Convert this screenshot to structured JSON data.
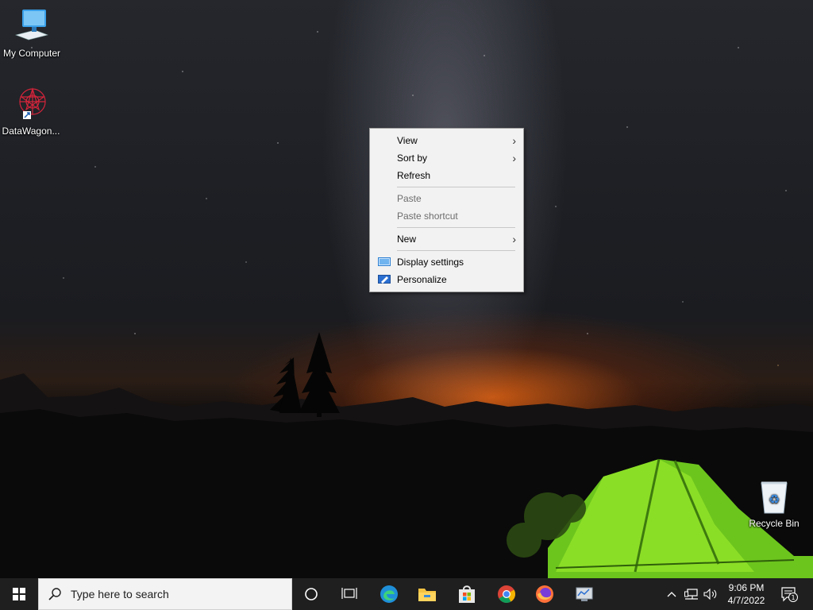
{
  "desktop": {
    "icons": [
      {
        "label": "My Computer"
      },
      {
        "label": "DataWagon..."
      },
      {
        "label": "Recycle Bin"
      }
    ]
  },
  "context_menu": {
    "items": [
      {
        "label": "View",
        "has_submenu": true,
        "enabled": true
      },
      {
        "label": "Sort by",
        "has_submenu": true,
        "enabled": true
      },
      {
        "label": "Refresh",
        "has_submenu": false,
        "enabled": true
      },
      {
        "label": "Paste",
        "has_submenu": false,
        "enabled": false
      },
      {
        "label": "Paste shortcut",
        "has_submenu": false,
        "enabled": false
      },
      {
        "label": "New",
        "has_submenu": true,
        "enabled": true
      },
      {
        "label": "Display settings",
        "icon": "display-icon",
        "enabled": true
      },
      {
        "label": "Personalize",
        "icon": "personalize-icon",
        "enabled": true
      }
    ]
  },
  "taskbar": {
    "search_placeholder": "Type here to search",
    "pinned_apps": [
      "edge-icon",
      "file-explorer-icon",
      "store-icon",
      "chrome-icon",
      "firefox-icon",
      "network-monitor-icon"
    ],
    "clock": {
      "time": "9:06 PM",
      "date": "4/7/2022"
    },
    "notification_count": "1"
  },
  "colors": {
    "taskbar": "#1f1f1f",
    "menu_bg": "#f2f2f2",
    "tent_green": "#7ed321"
  }
}
